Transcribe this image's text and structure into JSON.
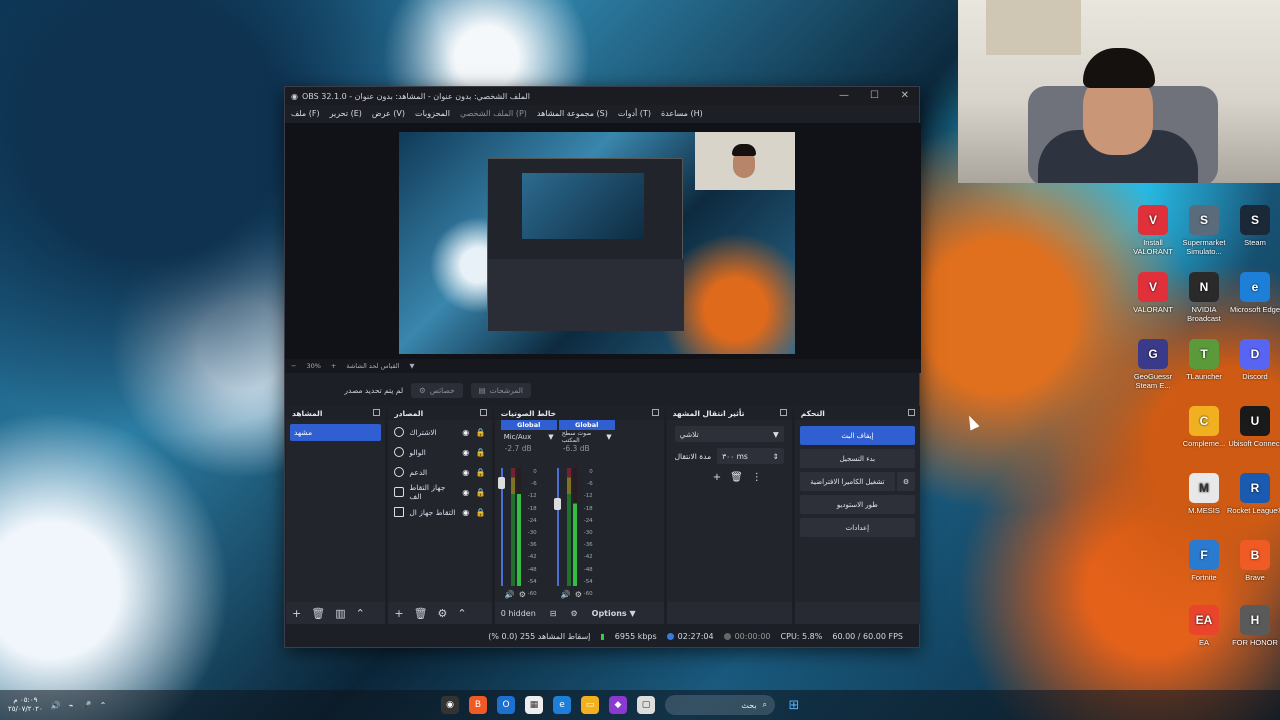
{
  "obs": {
    "title": "OBS 32.1.0 - الملف الشخصي: بدون عنوان - المشاهد: بدون عنوان",
    "menu": [
      "ملف (F)",
      "تحرير (E)",
      "عرض (V)",
      "المحزوبات",
      "الملف الشخصي (P)",
      "مجموعة المشاهد (S)",
      "أدوات (T)",
      "مساعدة (H)"
    ],
    "zoom": "30%",
    "zoom_label": "القياس لحد الشاشة",
    "ctx": {
      "no_source": "لم يتم تحديد مصدر",
      "properties": "خصائص",
      "filters": "المرشحات"
    },
    "panels": {
      "scenes": "المشاهد",
      "sources": "المصادر",
      "mixer": "خالط الصوتيات",
      "transitions": "تأثير انتقال المشهد",
      "controls": "التحكم"
    },
    "scenes": [
      "مشهد"
    ],
    "sources": [
      {
        "label": "الاشتراك",
        "icon": "globe-icon"
      },
      {
        "label": "الوالو",
        "icon": "globe-icon"
      },
      {
        "label": "الدعم",
        "icon": "globe-icon"
      },
      {
        "label": "جهاز التقاط الف",
        "icon": "camera-icon"
      },
      {
        "label": "التقاط جهاز ال",
        "icon": "monitor-icon"
      }
    ],
    "mixer": [
      {
        "tag": "Global",
        "name": "Mic/Aux",
        "db": "-2.7 dB",
        "level": 0.78,
        "fader": 0.92
      },
      {
        "tag": "Global",
        "name": "صوت سطح المكتب",
        "db": "-6.3 dB",
        "level": 0.7,
        "fader": 0.75
      }
    ],
    "mixer_scale": [
      "0",
      "-6",
      "-12",
      "-18",
      "-24",
      "-30",
      "-36",
      "-42",
      "-48",
      "-54",
      "-60"
    ],
    "mixer_foot": {
      "hidden": "0 hidden",
      "options": "Options"
    },
    "transition": {
      "selected": "تلاشي",
      "duration_label": "مدة الانتقال",
      "duration_value": "٣٠٠ ms"
    },
    "controls": [
      "إيقاف البث",
      "بدء التسجيل",
      "تشغيل الكاميرا الافتراضية",
      "طور الاستوديو",
      "إعدادات"
    ],
    "status": {
      "dropped": "إسقاط المشاهد 255 (0.0 %)",
      "kbps": "6955 kbps",
      "stream_time": "02:27:04",
      "rec_time": "00:00:00",
      "cpu": "CPU: 5.8%",
      "fps": "60.00 / 60.00 FPS"
    }
  },
  "desktop_icons": [
    {
      "label": "Install VALORANT",
      "color": "#e0303a",
      "glyph": "V"
    },
    {
      "label": "Supermarket Simulato...",
      "color": "#5a6b7c",
      "glyph": "S"
    },
    {
      "label": "Steam",
      "color": "#1b2838",
      "glyph": "S"
    },
    {
      "label": "VALORANT",
      "color": "#e0303a",
      "glyph": "V"
    },
    {
      "label": "NVIDIA Broadcast",
      "color": "#2a2a2a",
      "glyph": "N"
    },
    {
      "label": "Microsoft Edge",
      "color": "#1d7fd8",
      "glyph": "e"
    },
    {
      "label": "GeoGuessr Steam E...",
      "color": "#3a3a8a",
      "glyph": "G"
    },
    {
      "label": "TLauncher",
      "color": "#5a9a3a",
      "glyph": "T"
    },
    {
      "label": "Discord",
      "color": "#5865f2",
      "glyph": "D"
    },
    {
      "label": "Compleme...",
      "color": "#f0b020",
      "glyph": "C"
    },
    {
      "label": "Ubisoft Connect",
      "color": "#1a1a1a",
      "glyph": "U"
    },
    {
      "label": "M.MESIS",
      "color": "#e8e8e8",
      "glyph": "M"
    },
    {
      "label": "Rocket League®",
      "color": "#1a5ab0",
      "glyph": "R"
    },
    {
      "label": "Fortnite",
      "color": "#2a7ad0",
      "glyph": "F"
    },
    {
      "label": "Brave",
      "color": "#f05a24",
      "glyph": "B"
    },
    {
      "label": "EA",
      "color": "#e8452c",
      "glyph": "EA"
    },
    {
      "label": "FOR HONOR",
      "color": "#5a5a5a",
      "glyph": "H"
    }
  ],
  "taskbar": {
    "search": "بحث",
    "clock_time": "٠٥:٠٩ م",
    "clock_date": "٢٥/٠٧/٢٠٢٠"
  }
}
